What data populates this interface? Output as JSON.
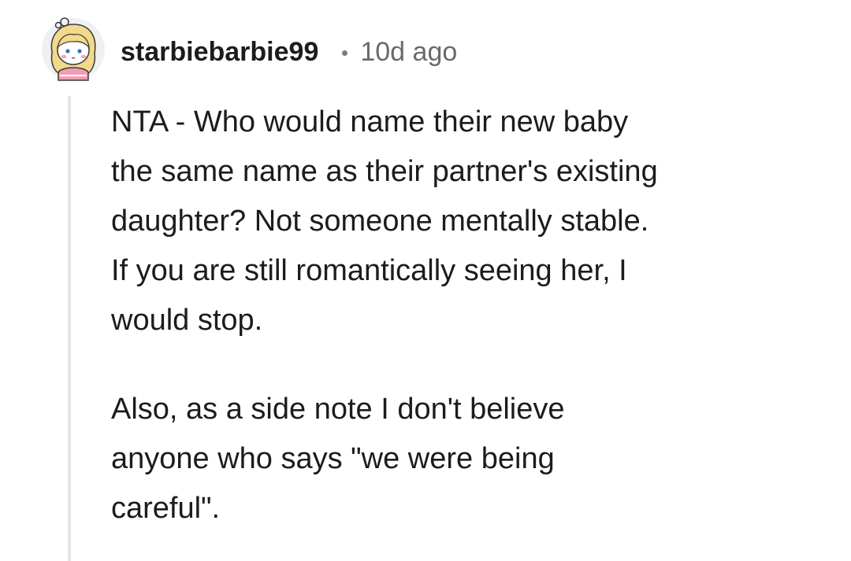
{
  "comment": {
    "author": "starbiebarbie99",
    "separator_icon": "bullet-dot",
    "timestamp": "10d ago",
    "avatar_icon": "snoo-avatar-blonde-girl",
    "paragraphs": [
      "NTA - Who would name their new baby\nthe same name as their partner's existing\ndaughter? Not someone mentally stable.\nIf you are still romantically seeing her, I\nwould stop.",
      "Also, as a side note I don't believe\nanyone who says \"we were being\ncareful\"."
    ]
  },
  "colors": {
    "text": "#1c1c1c",
    "timestamp": "#6a6a6a",
    "thread_line": "#e4e4e4",
    "background": "#ffffff"
  }
}
